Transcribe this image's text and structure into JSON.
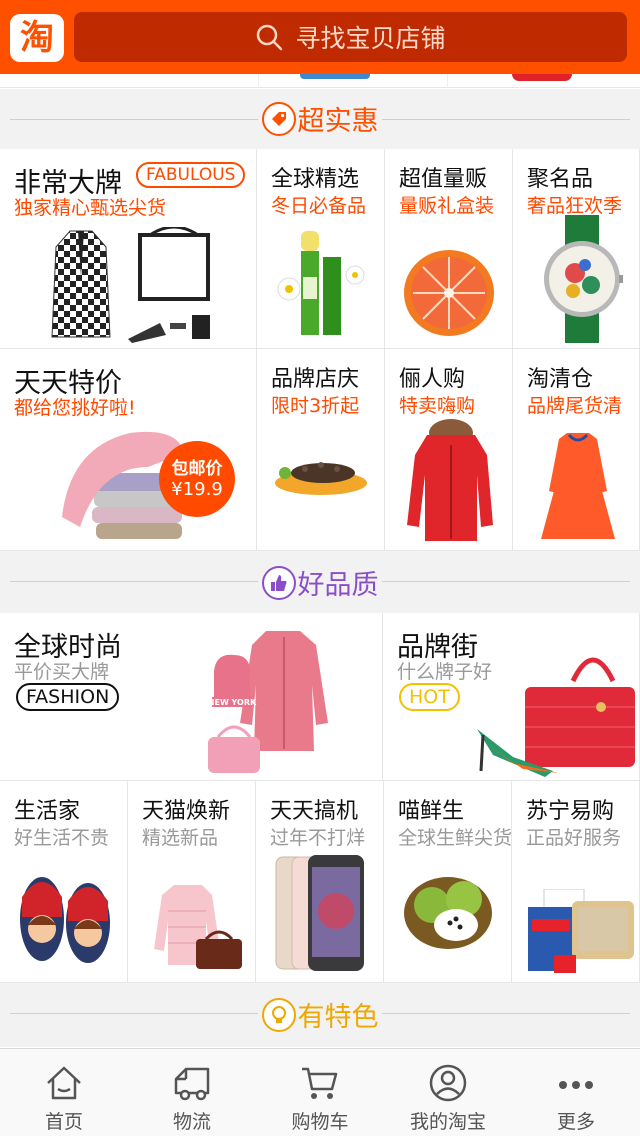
{
  "header": {
    "logo_text": "淘",
    "search_placeholder": "寻找宝贝店铺",
    "search_icon": "search-icon"
  },
  "sections": {
    "deals": "超实惠",
    "quality": "好品质",
    "special": "有特色"
  },
  "deals": {
    "brand": {
      "title": "非常大牌",
      "badge": "FABULOUS",
      "subtitle": "独家精心甄选尖货"
    },
    "global": {
      "title": "全球精选",
      "subtitle": "冬日必备品"
    },
    "value": {
      "title": "超值量贩",
      "subtitle": "量贩礼盒装"
    },
    "juming": {
      "title": "聚名品",
      "subtitle": "奢品狂欢季"
    },
    "daily": {
      "title": "天天特价",
      "subtitle": "都给您挑好啦!",
      "badge_line1": "包邮价",
      "badge_line2": "¥19.9"
    },
    "anniv": {
      "title": "品牌店庆",
      "subtitle": "限时3折起"
    },
    "couple": {
      "title": "俪人购",
      "subtitle": "特卖嗨购"
    },
    "clear": {
      "title": "淘清仓",
      "subtitle": "品牌尾货清"
    }
  },
  "quality": {
    "fashion": {
      "title": "全球时尚",
      "subtitle": "平价买大牌",
      "badge": "FASHION",
      "hat_text": "NEW YORK"
    },
    "brandstreet": {
      "title": "品牌街",
      "subtitle": "什么牌子好",
      "badge": "HOT"
    },
    "life": {
      "title": "生活家",
      "subtitle": "好生活不贵"
    },
    "tmall": {
      "title": "天猫焕新",
      "subtitle": "精选新品"
    },
    "gadget": {
      "title": "天天搞机",
      "subtitle": "过年不打烊"
    },
    "fresh": {
      "title": "喵鲜生",
      "subtitle": "全球生鲜尖货"
    },
    "suning": {
      "title": "苏宁易购",
      "subtitle": "正品好服务"
    }
  },
  "tabs": [
    {
      "label": "首页",
      "icon": "home-icon"
    },
    {
      "label": "物流",
      "icon": "truck-icon"
    },
    {
      "label": "购物车",
      "icon": "cart-icon"
    },
    {
      "label": "我的淘宝",
      "icon": "user-icon"
    },
    {
      "label": "更多",
      "icon": "more-icon"
    }
  ],
  "colors": {
    "accent": "#ff5000",
    "search_bg": "#c02a00",
    "quality_icon": "#8a4fc8",
    "special_icon": "#f0a800"
  }
}
